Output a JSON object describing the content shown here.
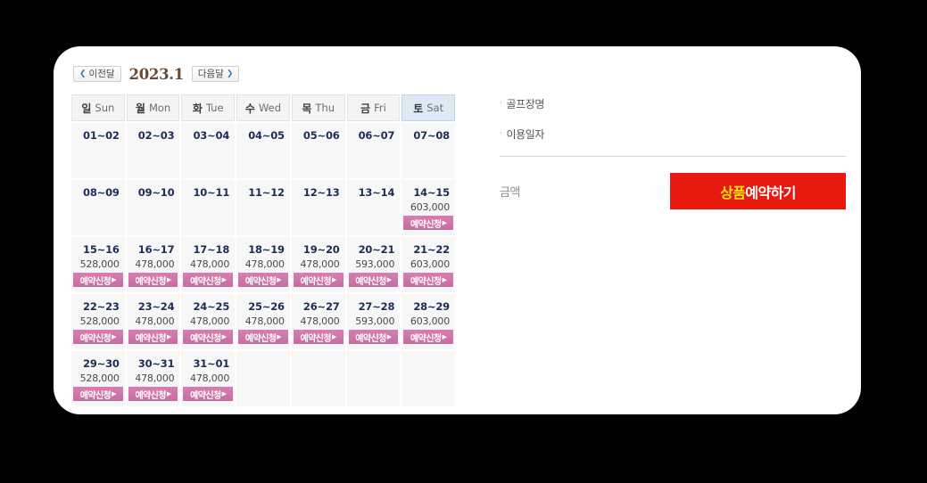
{
  "calendar": {
    "prev_label": "이전달",
    "next_label": "다음달",
    "prev_chevron": "❮",
    "next_chevron": "❯",
    "title": "2023.1",
    "day_headers": [
      {
        "ko": "일",
        "en": "Sun",
        "weekend": false
      },
      {
        "ko": "월",
        "en": "Mon",
        "weekend": false
      },
      {
        "ko": "화",
        "en": "Tue",
        "weekend": false
      },
      {
        "ko": "수",
        "en": "Wed",
        "weekend": false
      },
      {
        "ko": "목",
        "en": "Thu",
        "weekend": false
      },
      {
        "ko": "금",
        "en": "Fri",
        "weekend": false
      },
      {
        "ko": "토",
        "en": "Sat",
        "weekend": true
      }
    ],
    "book_label": "예약신청",
    "book_arrow": "▶",
    "weeks": [
      [
        {
          "date": "01~02",
          "price": null
        },
        {
          "date": "02~03",
          "price": null
        },
        {
          "date": "03~04",
          "price": null
        },
        {
          "date": "04~05",
          "price": null
        },
        {
          "date": "05~06",
          "price": null
        },
        {
          "date": "06~07",
          "price": null
        },
        {
          "date": "07~08",
          "price": null
        }
      ],
      [
        {
          "date": "08~09",
          "price": null
        },
        {
          "date": "09~10",
          "price": null
        },
        {
          "date": "10~11",
          "price": null
        },
        {
          "date": "11~12",
          "price": null
        },
        {
          "date": "12~13",
          "price": null
        },
        {
          "date": "13~14",
          "price": null
        },
        {
          "date": "14~15",
          "price": "603,000"
        }
      ],
      [
        {
          "date": "15~16",
          "price": "528,000"
        },
        {
          "date": "16~17",
          "price": "478,000"
        },
        {
          "date": "17~18",
          "price": "478,000"
        },
        {
          "date": "18~19",
          "price": "478,000"
        },
        {
          "date": "19~20",
          "price": "478,000"
        },
        {
          "date": "20~21",
          "price": "593,000"
        },
        {
          "date": "21~22",
          "price": "603,000"
        }
      ],
      [
        {
          "date": "22~23",
          "price": "528,000"
        },
        {
          "date": "23~24",
          "price": "478,000"
        },
        {
          "date": "24~25",
          "price": "478,000"
        },
        {
          "date": "25~26",
          "price": "478,000"
        },
        {
          "date": "26~27",
          "price": "478,000"
        },
        {
          "date": "27~28",
          "price": "593,000"
        },
        {
          "date": "28~29",
          "price": "603,000"
        }
      ],
      [
        {
          "date": "29~30",
          "price": "528,000"
        },
        {
          "date": "30~31",
          "price": "478,000"
        },
        {
          "date": "31~01",
          "price": "478,000"
        },
        {
          "date": null,
          "price": null
        },
        {
          "date": null,
          "price": null
        },
        {
          "date": null,
          "price": null
        },
        {
          "date": null,
          "price": null
        }
      ]
    ]
  },
  "detail": {
    "bullet": "·",
    "fields": [
      {
        "label": "골프장명",
        "value": ""
      },
      {
        "label": "이용일자",
        "value": ""
      }
    ],
    "amount_label": "금액",
    "amount_value": "",
    "reserve_button": {
      "highlight": "상품",
      "rest": "예약하기"
    }
  },
  "colors": {
    "page_background": "#000000",
    "panel_background": "#ffffff",
    "saturday_header": "#ddeaf5",
    "book_button": "#d07aae",
    "reserve_button": "#e8190f",
    "reserve_highlight_text": "#ffe600",
    "month_title": "#6b4a34",
    "date_text": "#1f2d55"
  }
}
